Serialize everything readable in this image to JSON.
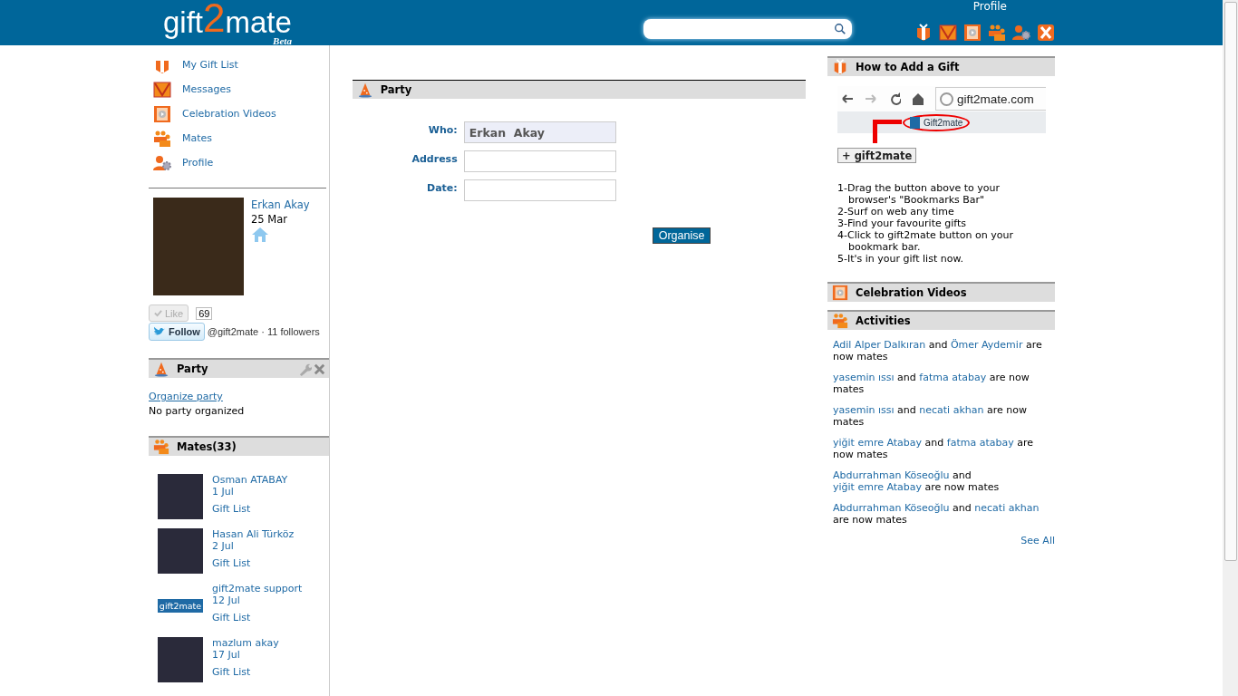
{
  "header": {
    "logo": {
      "before": "gift",
      "highlight": "2",
      "after": "mate",
      "tag": "Beta"
    },
    "profile_link": "Profile",
    "nav_icons": [
      {
        "kind": "gift"
      },
      {
        "kind": "envelope"
      },
      {
        "kind": "video"
      },
      {
        "kind": "people"
      },
      {
        "kind": "profile"
      },
      {
        "kind": "logout"
      }
    ]
  },
  "sidebar": {
    "items": [
      {
        "kind": "gift",
        "label": "My Gift List"
      },
      {
        "kind": "envelope",
        "label": "Messages"
      },
      {
        "kind": "video",
        "label": "Celebration Videos"
      },
      {
        "kind": "people",
        "label": "Mates"
      },
      {
        "kind": "profile",
        "label": "Profile"
      }
    ],
    "user": {
      "name": "Erkan Akay",
      "date": "25 Mar"
    },
    "social": {
      "like": "Like",
      "like_count": "69",
      "follow": "Follow",
      "handle": "@gift2mate",
      "followers": "· 11 followers"
    },
    "party_box": {
      "title": "Party",
      "link": "Organize party",
      "status": "No party organized"
    },
    "mates_box": {
      "title": "Mates(33)",
      "mates": [
        {
          "kind": "photo",
          "name": "Osman ATABAY",
          "date": "1 Jul",
          "link": "Gift List"
        },
        {
          "kind": "photo",
          "name": "Hasan Ali Türköz",
          "date": "2 Jul",
          "link": "Gift List"
        },
        {
          "kind": "logo",
          "logo_text": "gift2mate",
          "name": "gift2mate support",
          "date": "12 Jul",
          "link": "Gift List"
        },
        {
          "kind": "photo",
          "name": "mazlum akay",
          "date": "17 Jul",
          "link": "Gift List"
        }
      ]
    }
  },
  "main": {
    "title": "Party",
    "fields": [
      {
        "label": "Who:",
        "value": "Erkan  Akay",
        "disabled": true
      },
      {
        "label": "Address",
        "disabled": false
      },
      {
        "label": "Date:",
        "disabled": false
      }
    ],
    "button": "Organise"
  },
  "right": {
    "how_to": {
      "title": "How to Add a Gift",
      "browser_url": "gift2mate.com",
      "bookmark": "Gift2mate",
      "bookmarklet": "+ gift2mate",
      "steps": [
        "1-Drag the button above to your browser's \"Bookmarks Bar\"",
        "2-Surf on web any time",
        "3-Find your favourite gifts",
        "4-Click to gift2mate button on your bookmark bar.",
        "5-It's in your gift list now."
      ]
    },
    "videos_title": "Celebration Videos",
    "activities_title": "Activities",
    "activities": [
      {
        "first": "Adil Alper Dalkıran",
        "joiner": "and",
        "second": "Ömer Aydemir",
        "tail": "are now mates"
      },
      {
        "first": "yasemin ıssı",
        "joiner": "and",
        "second": "fatma atabay",
        "tail": "are now mates"
      },
      {
        "first": "yasemin ıssı",
        "joiner": "and",
        "second": "necati akhan",
        "tail": "are now mates"
      },
      {
        "first": "yiğit emre Atabay",
        "joiner": "and",
        "second": "fatma atabay",
        "tail": "are now mates"
      },
      {
        "first": "Abdurrahman Köseoğlu",
        "joiner": "and",
        "second": "yiğit emre Atabay",
        "tail": "are now mates"
      },
      {
        "first": "Abdurrahman Köseoğlu",
        "joiner": "and",
        "second": "necati akhan",
        "tail": "are now mates"
      }
    ],
    "see_all": "See All"
  }
}
